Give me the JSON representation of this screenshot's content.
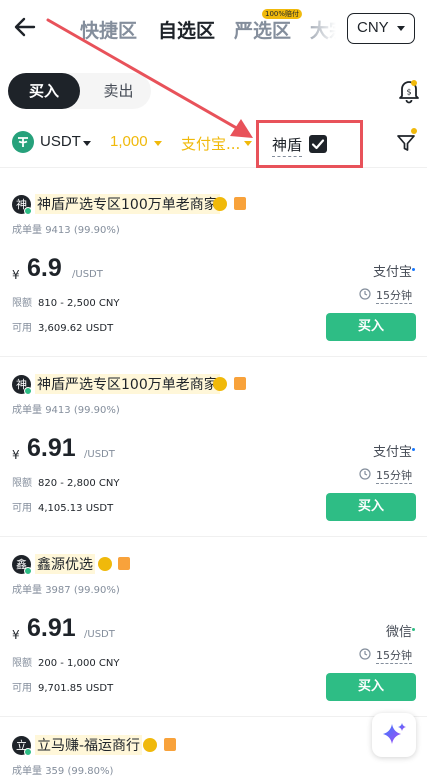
{
  "nav": {
    "tabs": [
      {
        "label": "快捷区",
        "active": false
      },
      {
        "label": "自选区",
        "active": true
      },
      {
        "label": "严选区",
        "active": false,
        "badge": "100%赔付"
      },
      {
        "label": "大宗",
        "active": false
      }
    ],
    "currency": "CNY"
  },
  "trade_toggle": {
    "buy_label": "买入",
    "sell_label": "卖出",
    "selected": "buy"
  },
  "filters": {
    "asset": "USDT",
    "amount": "1,000",
    "payment": "支付宝...",
    "shield_label": "神盾",
    "shield_checked": true
  },
  "ads": [
    {
      "avatar": "神",
      "merchant": "神盾严选专区100万单老商家",
      "orders_label": "成单量",
      "orders": "9413 (99.90%)",
      "currency_symbol": "¥",
      "price": "6.9",
      "unit": "/USDT",
      "limit_label": "限额",
      "limit": "810 - 2,500 CNY",
      "available_label": "可用",
      "available": "3,609.62 USDT",
      "payment": "支付宝",
      "time": "15分钟",
      "button": "买入"
    },
    {
      "avatar": "神",
      "merchant": "神盾严选专区100万单老商家",
      "orders_label": "成单量",
      "orders": "9413 (99.90%)",
      "currency_symbol": "¥",
      "price": "6.91",
      "unit": "/USDT",
      "limit_label": "限额",
      "limit": "820 - 2,800 CNY",
      "available_label": "可用",
      "available": "4,105.13 USDT",
      "payment": "支付宝",
      "time": "15分钟",
      "button": "买入"
    },
    {
      "avatar": "鑫",
      "merchant": "鑫源优选",
      "orders_label": "成单量",
      "orders": "3987 (99.90%)",
      "currency_symbol": "¥",
      "price": "6.91",
      "unit": "/USDT",
      "limit_label": "限额",
      "limit": "200 - 1,000 CNY",
      "available_label": "可用",
      "available": "9,701.85 USDT",
      "payment": "微信",
      "time": "15分钟",
      "button": "买入"
    },
    {
      "avatar": "立",
      "merchant": "立马赚-福运商行",
      "orders_label": "成单量",
      "orders": "359 (99.80%)"
    }
  ],
  "colors": {
    "brand_gold": "#f0b90b",
    "buy_green": "#2ebd85",
    "annotation_red": "#e8525a",
    "text_dark": "#1e2329",
    "text_gray": "#848e9c"
  }
}
